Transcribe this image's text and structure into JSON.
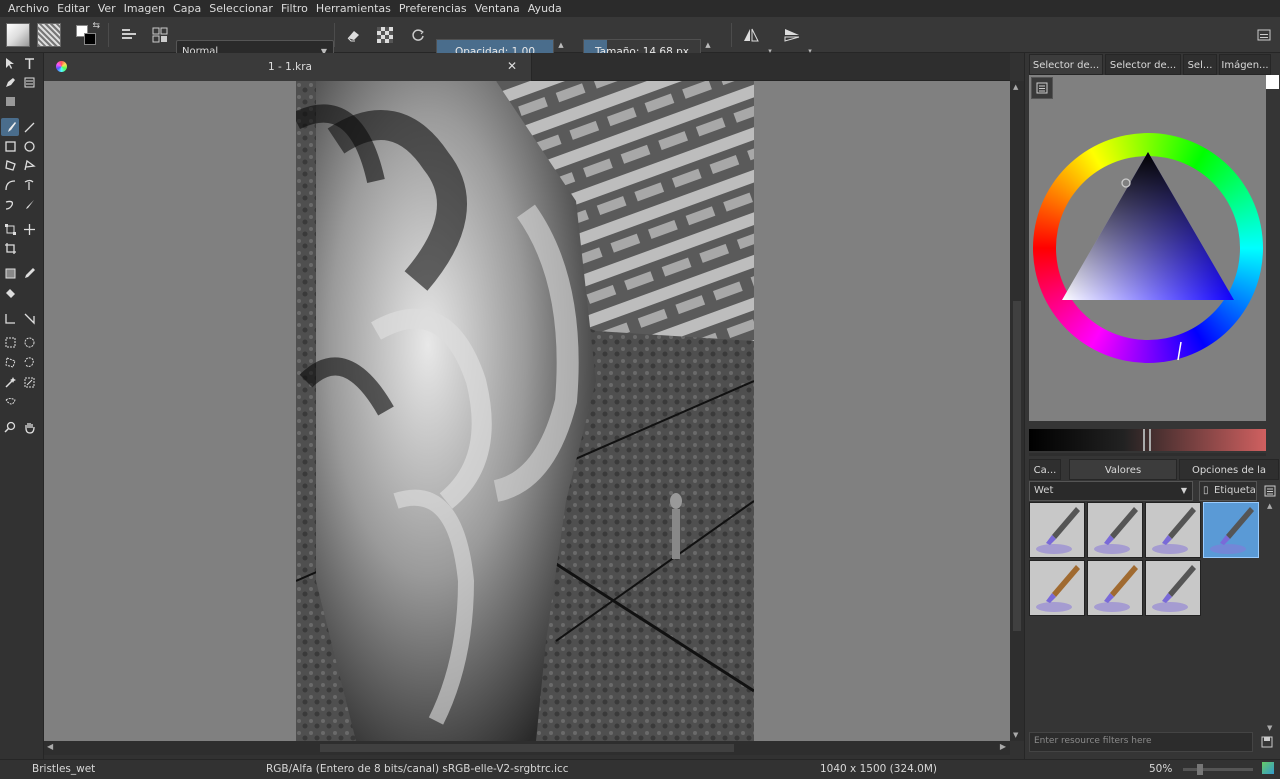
{
  "menu": [
    "Archivo",
    "Editar",
    "Ver",
    "Imagen",
    "Capa",
    "Seleccionar",
    "Filtro",
    "Herramientas",
    "Preferencias",
    "Ventana",
    "Ayuda"
  ],
  "toolbar": {
    "blend_mode": "Normal",
    "opacity_label": "Opacidad:",
    "opacity_value": "1,00",
    "opacity_fraction": 1.0,
    "size_label": "Tamaño:",
    "size_value": "14,68 px",
    "size_fraction": 0.2
  },
  "document": {
    "tab_title": "1 - 1.kra"
  },
  "right_panel": {
    "tabs": [
      "Selector de...",
      "Selector de...",
      "Sel...",
      "Imágen..."
    ],
    "bottom_tabs": [
      "Ca...",
      "Valores predefinidos...",
      "Opciones de la he..."
    ],
    "preset_tag": "Wet",
    "tag_button": "Etiqueta",
    "filter_placeholder": "Enter resource filters here"
  },
  "status": {
    "brush": "Bristles_wet",
    "color_space": "RGB/Alfa (Entero de 8 bits/canal)  sRGB-elle-V2-srgbtrc.icc",
    "dimensions": "1040 x 1500 (324.0M)",
    "zoom": "50%"
  },
  "colors": {
    "accent": "#4a6d8c",
    "selected_preset": "#5a9ad6"
  }
}
